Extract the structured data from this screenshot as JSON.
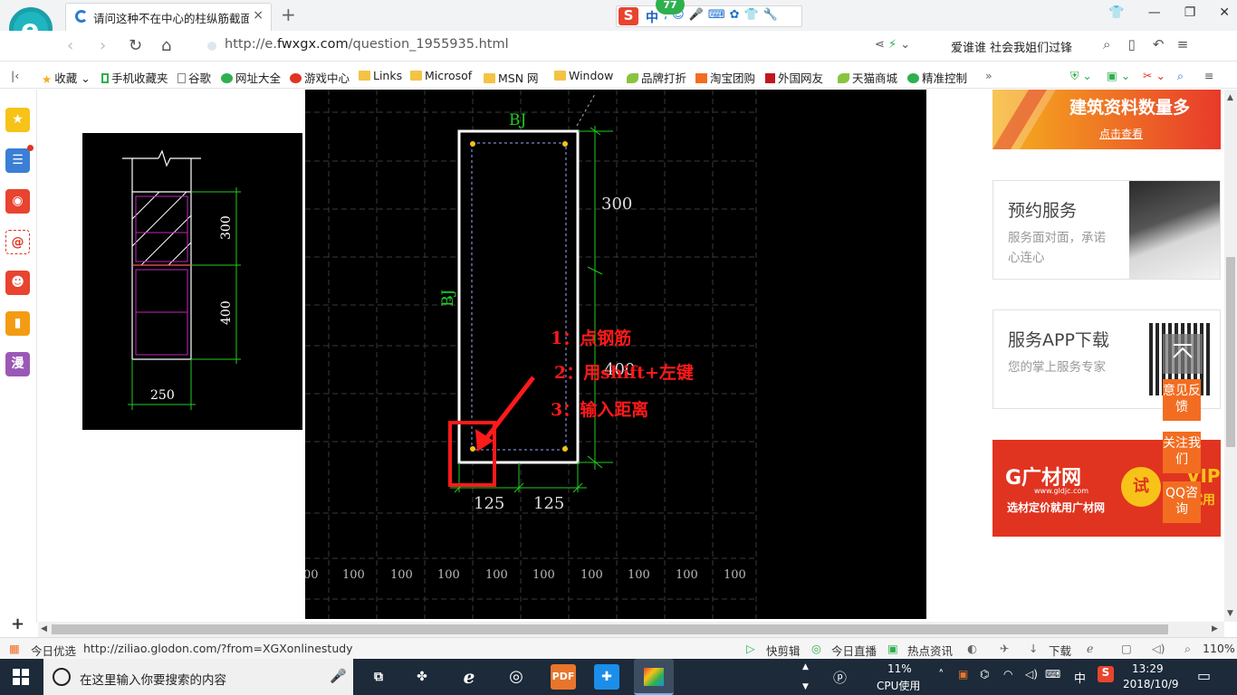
{
  "tab": {
    "title": "请问这种不在中心的柱纵筋截面",
    "close": "×"
  },
  "new_tab": "+",
  "ime": {
    "logo": "S",
    "mode": "中",
    "badge": "77"
  },
  "window": {
    "min": "—",
    "restore": "❐",
    "close": "✕"
  },
  "address": {
    "prefix": "http://e.",
    "domain": "fwxgx.com",
    "path": "/question_1955935.html",
    "search_text": "爱谁谁 社会我姐们过锋"
  },
  "bookmarks": [
    {
      "label": "收藏",
      "icon": "star-icon"
    },
    {
      "label": "手机收藏夹",
      "icon": "phone-icon"
    },
    {
      "label": "谷歌",
      "icon": "page-icon"
    },
    {
      "label": "网址大全",
      "icon": "globe-icon"
    },
    {
      "label": "游戏中心",
      "icon": "game-icon"
    },
    {
      "label": "Links",
      "icon": "folder-icon"
    },
    {
      "label": "Microsof",
      "icon": "folder-icon"
    },
    {
      "label": "MSN 网",
      "icon": "folder-icon"
    },
    {
      "label": "Window",
      "icon": "folder-icon"
    },
    {
      "label": "品牌打折",
      "icon": "leaf-icon"
    },
    {
      "label": "淘宝团购",
      "icon": "taobao-icon"
    },
    {
      "label": "外国网友",
      "icon": "gate-icon"
    },
    {
      "label": "天猫商城",
      "icon": "leaf-icon"
    },
    {
      "label": "精准控制",
      "icon": "chat-icon"
    }
  ],
  "sidebar_icons": [
    "star-icon",
    "news-icon",
    "weibo-icon",
    "mail-icon",
    "game-icon",
    "book-icon",
    "comic-icon"
  ],
  "sidebar_comic": "漫",
  "cad_small": {
    "dims": [
      "300",
      "400",
      "250"
    ]
  },
  "cad_main": {
    "label_top": "BJ",
    "label_left": "BJ",
    "dim_300": "300",
    "dim_400": "400",
    "dim_125a": "125",
    "dim_125b": "125",
    "ruler": [
      "00",
      "100",
      "100",
      "100",
      "100",
      "100",
      "100",
      "100",
      "100",
      "100"
    ]
  },
  "annotations": [
    "1：点钢筋",
    "2：用shift+左键",
    "3：输入距离"
  ],
  "right_ads": {
    "banner1_title": "建筑资料数量多",
    "banner1_link": "点击查看",
    "card1_title": "预约服务",
    "card1_sub": "服务面对面，承诺心连心",
    "card2_title": "服务APP下载",
    "card2_sub": "您的掌上服务专家",
    "banner2_logo": "G广材网",
    "banner2_url": "www.gldjc.com",
    "banner2_sub": "选材定价就用广材网",
    "banner2_try": "试",
    "banner2_vip": "VIP",
    "banner2_vip_sub": "试用"
  },
  "float_buttons": [
    "意见反馈",
    "关注我们",
    "QQ咨询"
  ],
  "statusbar": {
    "left_label": "今日优选",
    "url": "http://ziliao.glodon.com/?from=XGXonlinestudy",
    "items": [
      "快剪辑",
      "今日直播",
      "热点资讯",
      "下载"
    ],
    "zoom": "110%"
  },
  "taskbar": {
    "search_placeholder": "在这里输入你要搜索的内容",
    "cpu_value": "11%",
    "cpu_label": "CPU使用",
    "lang": "中",
    "time": "13:29",
    "date": "2018/10/9"
  },
  "colors": {
    "cad_bg": "#000000",
    "cad_green": "#22cc22",
    "annotation_red": "#ff1a1a",
    "accent_orange": "#f26d21"
  }
}
